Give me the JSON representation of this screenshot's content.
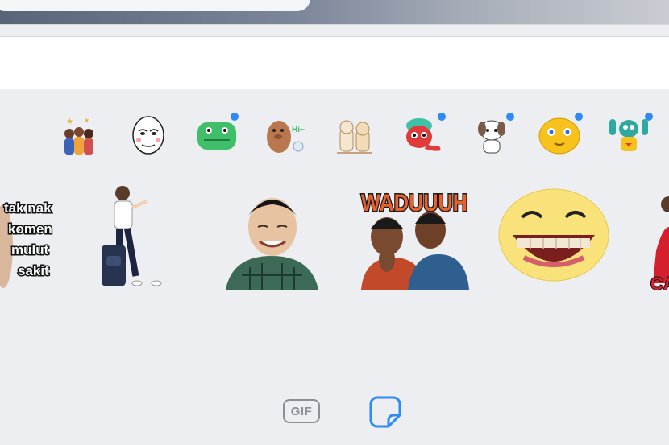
{
  "packs": [
    {
      "icon": "friends-pack-icon",
      "new": false
    },
    {
      "icon": "mask-face-pack-icon",
      "new": false
    },
    {
      "icon": "green-dino-pack-icon",
      "new": true
    },
    {
      "icon": "brown-bear-pack-icon",
      "new": false
    },
    {
      "icon": "dog-cat-pack-icon",
      "new": false
    },
    {
      "icon": "red-creature-pack-icon",
      "new": true
    },
    {
      "icon": "puppy-pack-icon",
      "new": true
    },
    {
      "icon": "yellow-blob-pack-icon",
      "new": true
    },
    {
      "icon": "teal-monster-pack-icon",
      "new": true
    }
  ],
  "stickers": {
    "caption_lines": [
      "tak nak",
      "komen",
      "mulut",
      "sakit"
    ],
    "waduh_text": "WADUUUH",
    "partial_text": "CA"
  },
  "tabs": {
    "gif_label": "GIF",
    "active_tab": "stickers"
  },
  "colors": {
    "accent": "#2e8af6",
    "panel_bg": "#eceef1",
    "tab_inactive": "#8b8f96"
  }
}
